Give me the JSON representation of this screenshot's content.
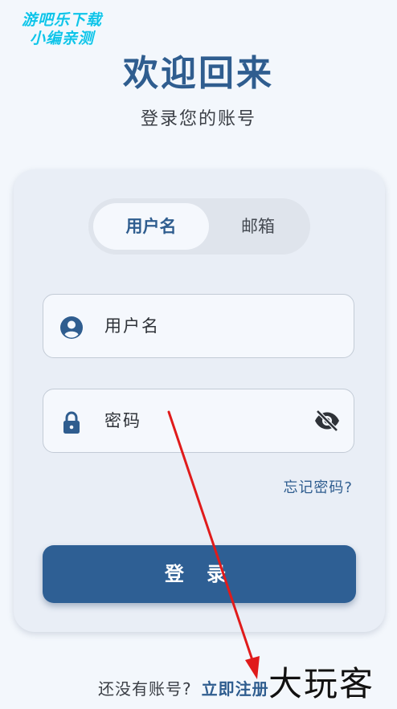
{
  "watermark_top": {
    "line1": "游吧乐下载",
    "line2": "小编亲测"
  },
  "header": {
    "title": "欢迎回来",
    "subtitle": "登录您的账号"
  },
  "tabs": [
    {
      "label": "用户名",
      "active": true
    },
    {
      "label": "邮箱",
      "active": false
    }
  ],
  "form": {
    "username_placeholder": "用户名",
    "password_placeholder": "密码",
    "forgot_label": "忘记密码?",
    "login_label": "登 录"
  },
  "footer": {
    "prompt": "还没有账号?",
    "register_label": "立即注册"
  },
  "watermark_bottom": "大玩客",
  "colors": {
    "primary": "#2e5f94",
    "background": "#f3f7fc",
    "card": "#e9eef6",
    "annotation_arrow": "#e01b1b"
  },
  "icons": {
    "username": "account-circle-icon",
    "password": "lock-icon",
    "visibility": "eye-off-icon"
  }
}
